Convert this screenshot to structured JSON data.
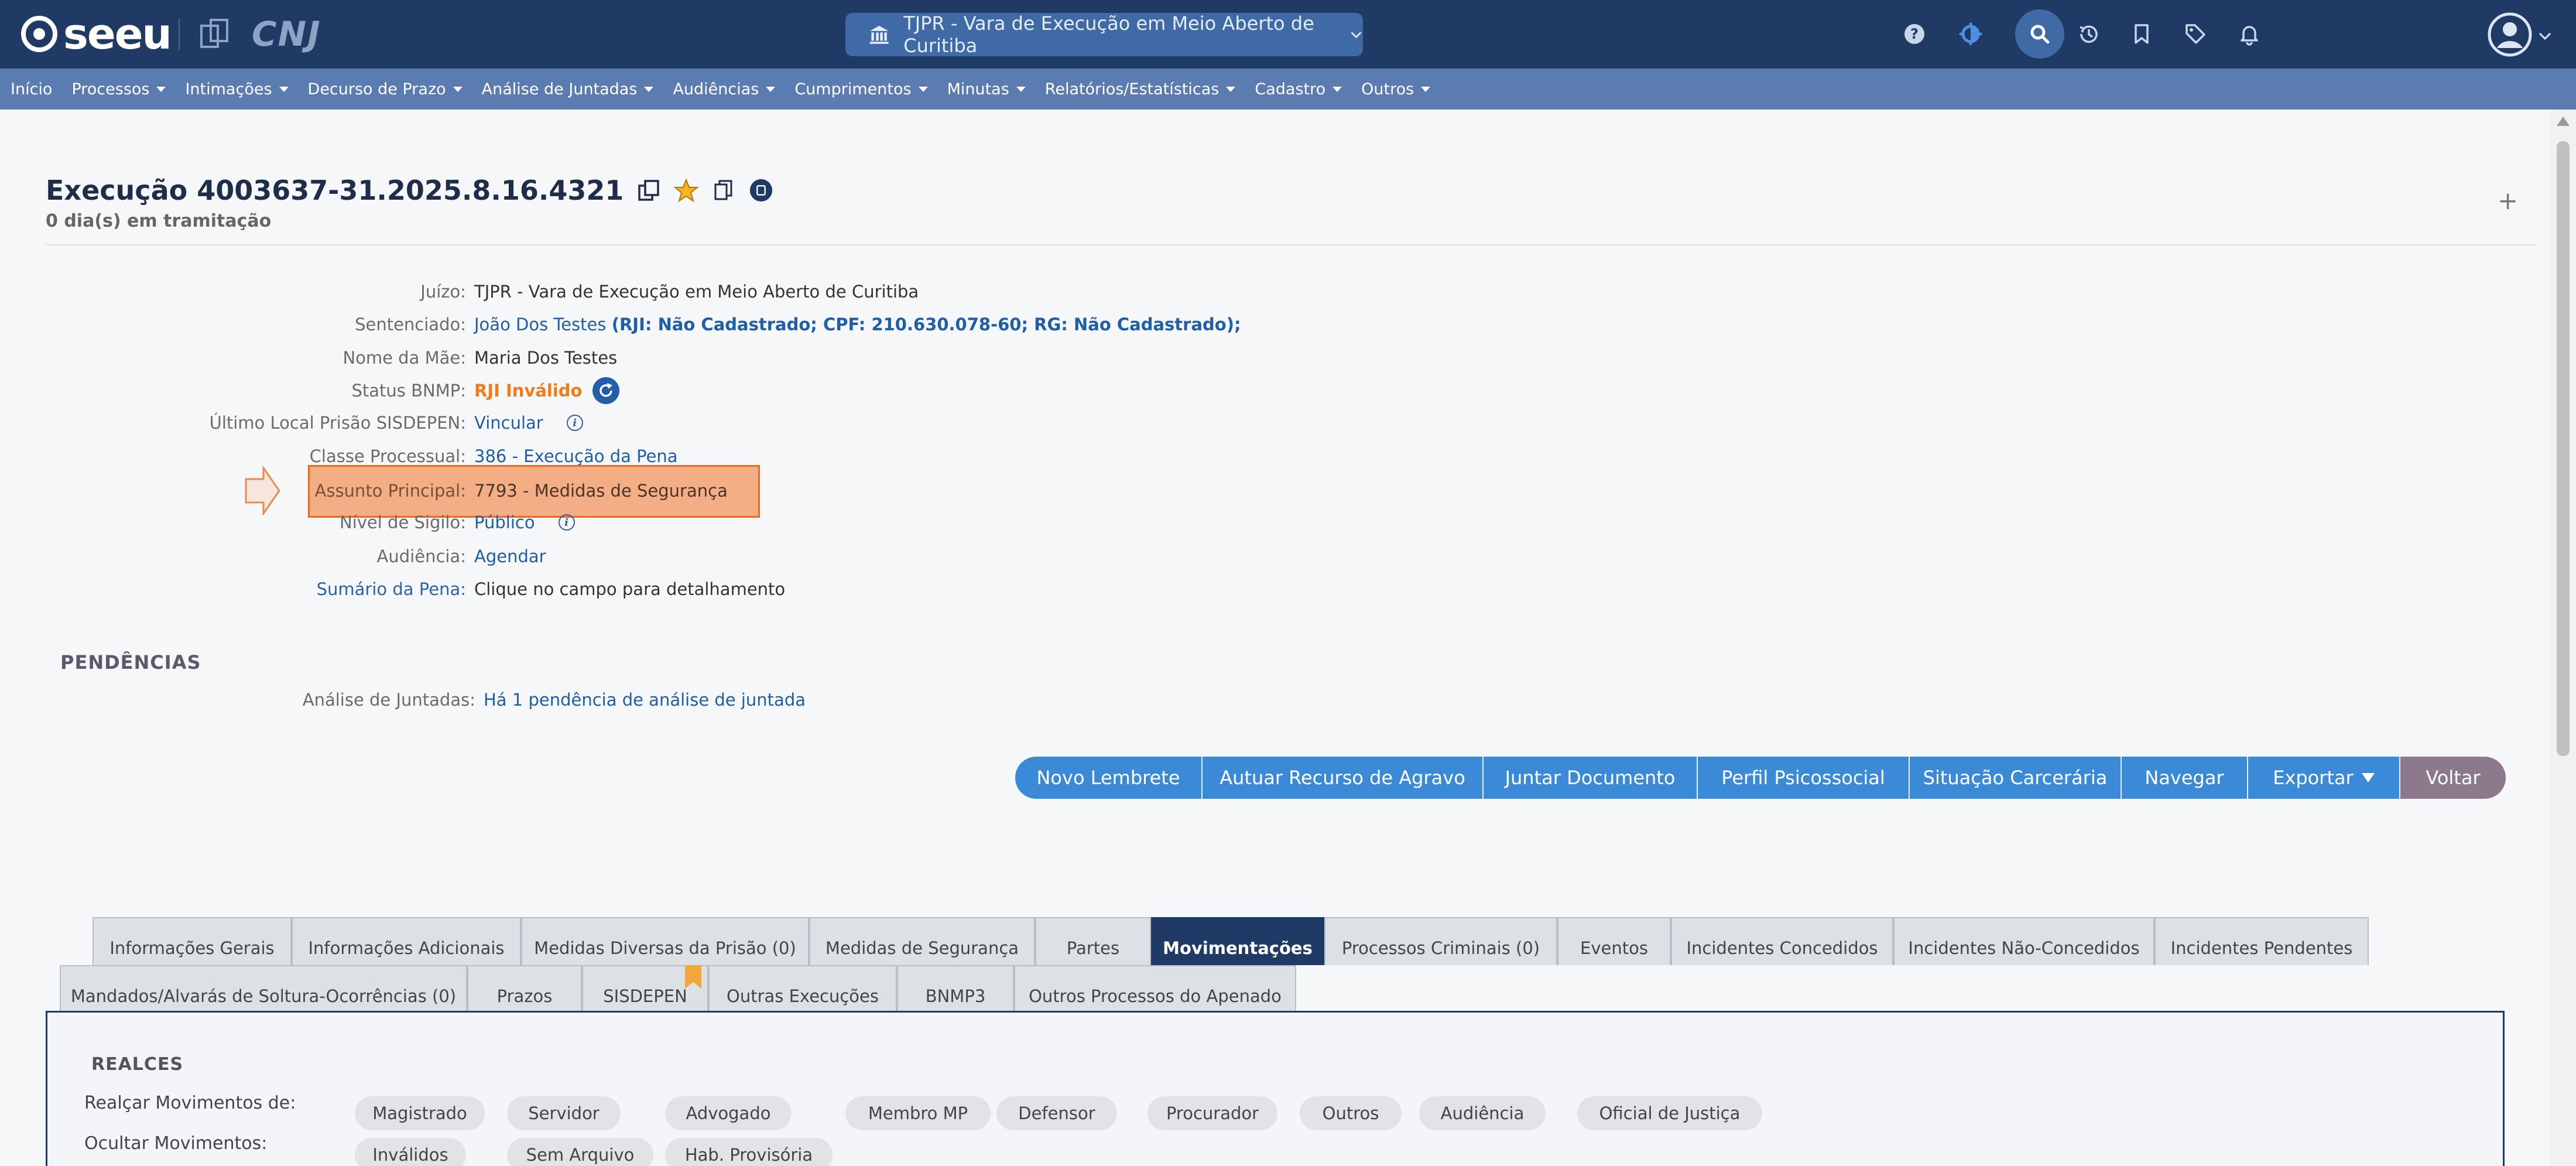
{
  "header": {
    "logo_text": "seeu",
    "cnj_text": "CNJ",
    "court_select": "TJPR - Vara de Execução em Meio Aberto de Curitiba",
    "icons": [
      "help-icon",
      "contrast-icon",
      "search-icon",
      "history-icon",
      "bookmark-icon",
      "tag-icon",
      "bell-icon",
      "user-avatar-icon"
    ]
  },
  "menu": [
    {
      "label": "Início",
      "dropdown": false
    },
    {
      "label": "Processos",
      "dropdown": true
    },
    {
      "label": "Intimações",
      "dropdown": true
    },
    {
      "label": "Decurso de Prazo",
      "dropdown": true
    },
    {
      "label": "Análise de Juntadas",
      "dropdown": true
    },
    {
      "label": "Audiências",
      "dropdown": true
    },
    {
      "label": "Cumprimentos",
      "dropdown": true
    },
    {
      "label": "Minutas",
      "dropdown": true
    },
    {
      "label": "Relatórios/Estatísticas",
      "dropdown": true
    },
    {
      "label": "Cadastro",
      "dropdown": true
    },
    {
      "label": "Outros",
      "dropdown": true
    }
  ],
  "process": {
    "title": "Execução 4003637-31.2025.8.16.4321",
    "days": "0 dia(s) em tramitação",
    "plus": "+"
  },
  "fields": {
    "juizo_label": "Juízo:",
    "juizo_value": "TJPR - Vara de Execução em Meio Aberto de Curitiba",
    "sentenciado_label": "Sentenciado:",
    "sentenciado_name": "João Dos Testes",
    "sentenciado_docs": "(RJI: Não Cadastrado; CPF: 210.630.078-60; RG: Não Cadastrado);",
    "mae_label": "Nome da Mãe:",
    "mae_value": "Maria Dos Testes",
    "bnmp_label": "Status BNMP:",
    "bnmp_value": "RJI Inválido",
    "sisdepen_label": "Último Local Prisão SISDEPEN:",
    "sisdepen_value": "Vincular",
    "classe_label": "Classe Processual:",
    "classe_value": "386 - Execução da Pena",
    "assunto_label": "Assunto Principal:",
    "assunto_value": "7793 - Medidas de Segurança",
    "sigilo_label": "Nível de Sigilo:",
    "sigilo_value": "Público",
    "audiencia_label": "Audiência:",
    "audiencia_value": "Agendar",
    "sumario_label": "Sumário da Pena:",
    "sumario_value": "Clique no campo para detalhamento",
    "info_glyph": "i"
  },
  "pendencias": {
    "title": "PENDÊNCIAS",
    "juntadas_label": "Análise de Juntadas:",
    "juntadas_value": "Há 1 pendência de análise de juntada"
  },
  "actions": [
    "Novo Lembrete",
    "Autuar Recurso de Agravo",
    "Juntar Documento",
    "Perfil Psicossocial",
    "Situação Carcerária",
    "Navegar",
    "Exportar",
    "Voltar"
  ],
  "tabs_row1": [
    "Informações Gerais",
    "Informações Adicionais",
    "Medidas Diversas da Prisão (0)",
    "Medidas de Segurança",
    "Partes",
    "Movimentações",
    "Processos Criminais (0)",
    "Eventos",
    "Incidentes Concedidos",
    "Incidentes Não-Concedidos",
    "Incidentes Pendentes"
  ],
  "tabs_row2": [
    "Mandados/Alvarás de Soltura-Ocorrências (0)",
    "Prazos",
    "SISDEPEN",
    "Outras Execuções",
    "BNMP3",
    "Outros Processos do Apenado"
  ],
  "active_tab": "Movimentações",
  "realces": {
    "title": "REALCES",
    "realcar_label": "Realçar Movimentos de:",
    "ocultar_label": "Ocultar Movimentos:",
    "realcar_pills": [
      "Magistrado",
      "Servidor",
      "Advogado",
      "Membro MP",
      "Defensor",
      "Procurador",
      "Outros",
      "Audiência",
      "Oficial de Justiça"
    ],
    "ocultar_pills": [
      "Inválidos",
      "Sem Arquivo",
      "Hab. Provisória"
    ]
  },
  "colors": {
    "topbar": "#1f3a64",
    "menubar": "#5b7cb1",
    "action_blue": "#3b8ad8",
    "back_button": "#8c7a8c",
    "status_orange": "#ef7c16",
    "highlight": "#f2965f"
  }
}
